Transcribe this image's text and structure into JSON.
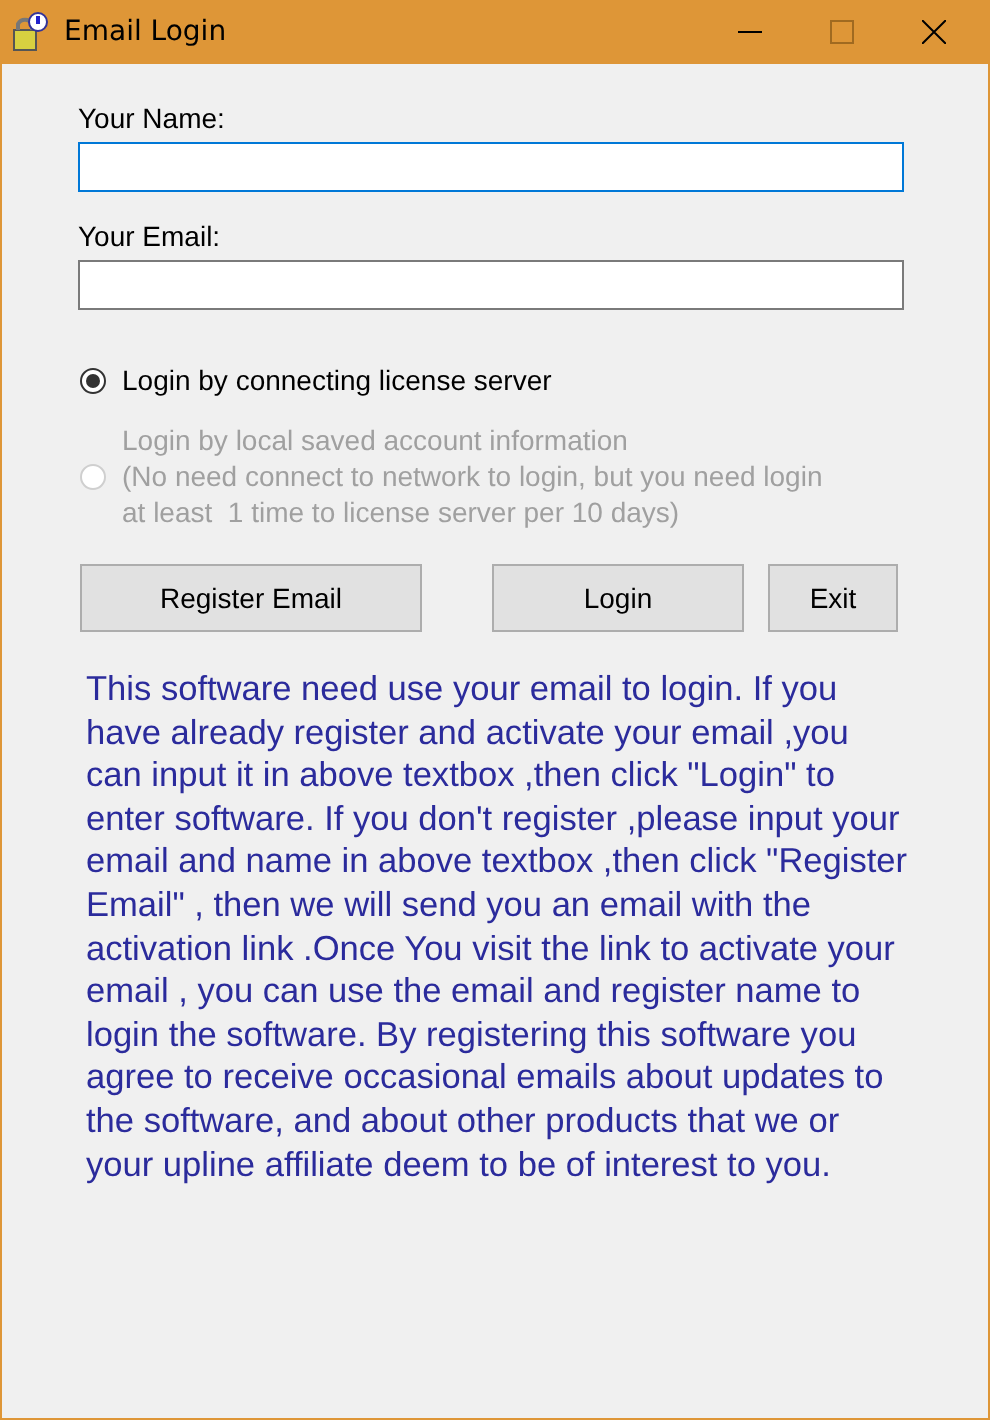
{
  "window": {
    "title": "Email Login"
  },
  "fields": [
    {
      "label": "Your Name:",
      "focused": true
    },
    {
      "label": "Your Email:",
      "focused": false
    }
  ],
  "login_options": [
    {
      "label": "Login by connecting license server",
      "selected": true,
      "disabled": false
    },
    {
      "label": "Login by local saved account information\n(No need connect to network to login, but you need login\nat least  1 time to license server per 10 days)",
      "selected": false,
      "disabled": true
    }
  ],
  "buttons": [
    "Register Email",
    "Login",
    "Exit"
  ],
  "info_text": "This software need use your email to login. If you have already register and activate your email ,you can input it in above textbox ,then click \"Login\" to enter software. If you don't register ,please input your email and name in above textbox ,then click \"Register Email\" , then we will send you an email with the activation link .Once You visit the link to activate your email , you can use the email and register name to login the software. By registering this software you agree to receive occasional emails about updates to the software, and about other products that we or your upline affiliate deem to be of interest to you."
}
